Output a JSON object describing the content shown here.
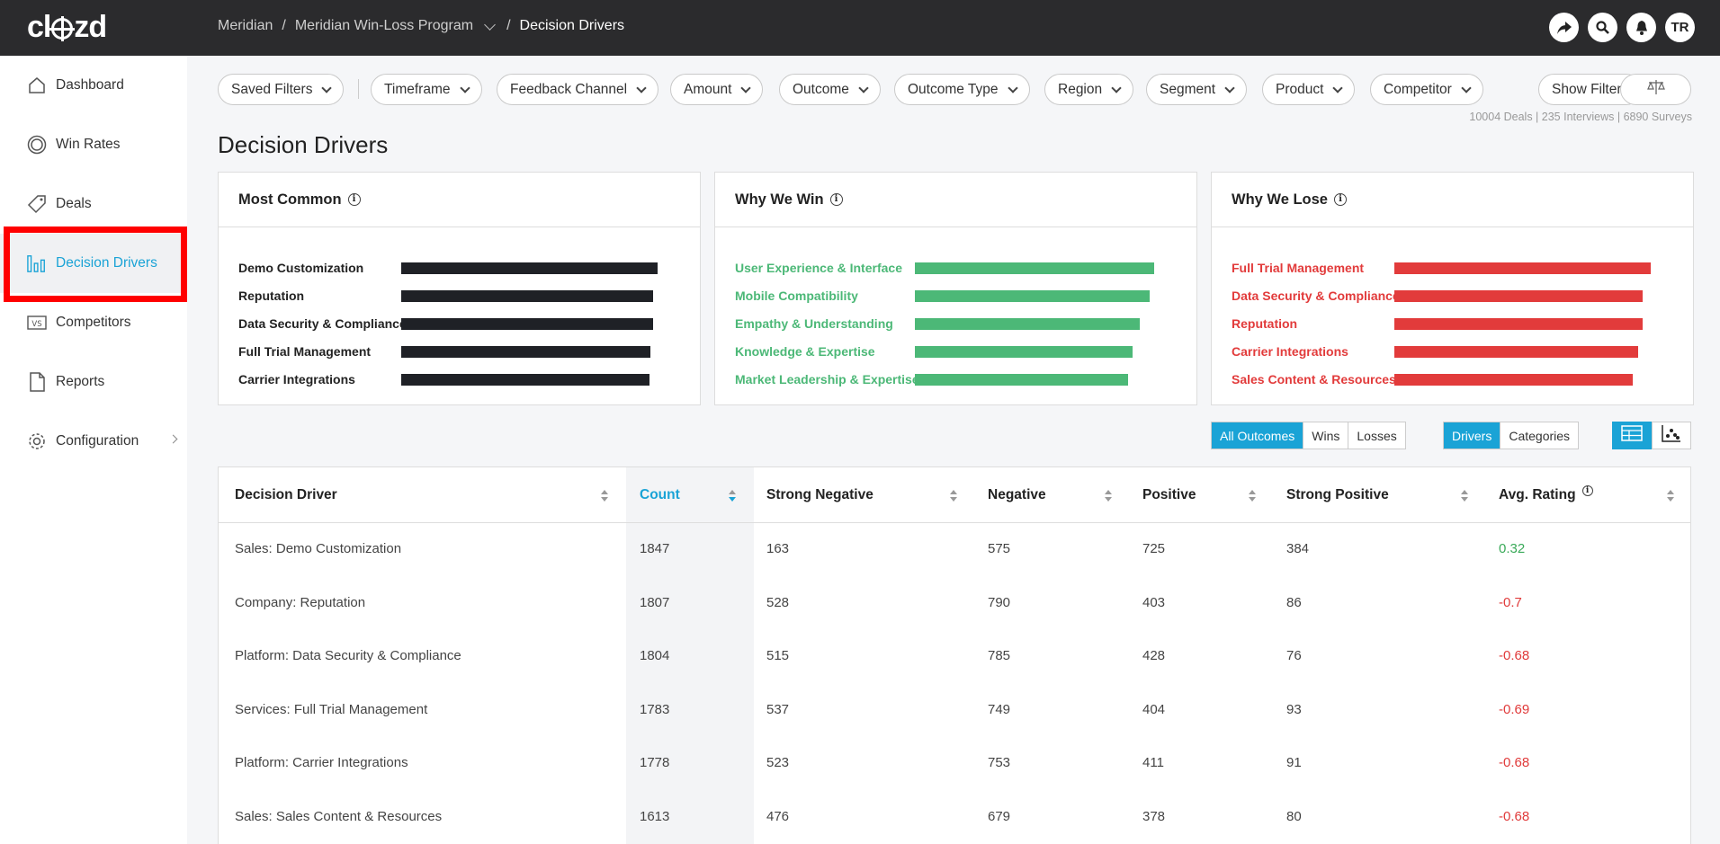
{
  "app": {
    "logo": "clozd"
  },
  "breadcrumb": {
    "items": [
      "Meridian",
      "Meridian Win-Loss Program",
      "Decision Drivers"
    ]
  },
  "header": {
    "user_initials": "TR",
    "icons": [
      "share-icon",
      "search-icon",
      "bell-icon"
    ]
  },
  "sidebar": {
    "items": [
      {
        "label": "Dashboard",
        "icon": "home-icon"
      },
      {
        "label": "Win Rates",
        "icon": "target-icon"
      },
      {
        "label": "Deals",
        "icon": "tag-icon"
      },
      {
        "label": "Decision Drivers",
        "icon": "bar-chart-icon"
      },
      {
        "label": "Competitors",
        "icon": "vs-icon"
      },
      {
        "label": "Reports",
        "icon": "document-icon"
      },
      {
        "label": "Configuration",
        "icon": "gear-icon"
      }
    ]
  },
  "filters": {
    "saved": "Saved Filters",
    "items": [
      "Timeframe",
      "Feedback Channel",
      "Amount",
      "Outcome",
      "Outcome Type",
      "Region",
      "Segment",
      "Product",
      "Competitor"
    ],
    "show_filters": "Show Filters",
    "summary": "10004 Deals | 235 Interviews | 6890 Surveys"
  },
  "page": {
    "title": "Decision Drivers"
  },
  "cards": {
    "most_common": {
      "title": "Most Common",
      "color": "#1f2126",
      "rows": [
        {
          "label": "Demo Customization",
          "value": 1847
        },
        {
          "label": "Reputation",
          "value": 1807
        },
        {
          "label": "Data Security & Compliance",
          "value": 1804
        },
        {
          "label": "Full Trial Management",
          "value": 1783
        },
        {
          "label": "Carrier Integrations",
          "value": 1778
        }
      ]
    },
    "why_win": {
      "title": "Why We Win",
      "color": "#4cb877",
      "rows": [
        {
          "label": "User Experience & Interface",
          "value": 1.0
        },
        {
          "label": "Mobile Compatibility",
          "value": 0.98
        },
        {
          "label": "Empathy & Understanding",
          "value": 0.94
        },
        {
          "label": "Knowledge & Expertise",
          "value": 0.91
        },
        {
          "label": "Market Leadership & Expertise",
          "value": 0.89
        }
      ]
    },
    "why_lose": {
      "title": "Why We Lose",
      "color": "#e23b3b",
      "rows": [
        {
          "label": "Full Trial Management",
          "value": 1.0
        },
        {
          "label": "Data Security & Compliance",
          "value": 0.97
        },
        {
          "label": "Reputation",
          "value": 0.97
        },
        {
          "label": "Carrier Integrations",
          "value": 0.95
        },
        {
          "label": "Sales Content & Resources",
          "value": 0.93
        }
      ]
    }
  },
  "toggles": {
    "outcomes": [
      "All Outcomes",
      "Wins",
      "Losses"
    ],
    "grouping": [
      "Drivers",
      "Categories"
    ]
  },
  "table": {
    "columns": [
      "Decision Driver",
      "Count",
      "Strong Negative",
      "Negative",
      "Positive",
      "Strong Positive",
      "Avg. Rating"
    ],
    "rows": [
      [
        "Sales: Demo Customization",
        "1847",
        "163",
        "575",
        "725",
        "384",
        "0.32"
      ],
      [
        "Company: Reputation",
        "1807",
        "528",
        "790",
        "403",
        "86",
        "-0.7"
      ],
      [
        "Platform: Data Security & Compliance",
        "1804",
        "515",
        "785",
        "428",
        "76",
        "-0.68"
      ],
      [
        "Services: Full Trial Management",
        "1783",
        "537",
        "749",
        "404",
        "93",
        "-0.69"
      ],
      [
        "Platform: Carrier Integrations",
        "1778",
        "523",
        "753",
        "411",
        "91",
        "-0.68"
      ],
      [
        "Sales: Sales Content & Resources",
        "1613",
        "476",
        "679",
        "378",
        "80",
        "-0.68"
      ]
    ]
  }
}
